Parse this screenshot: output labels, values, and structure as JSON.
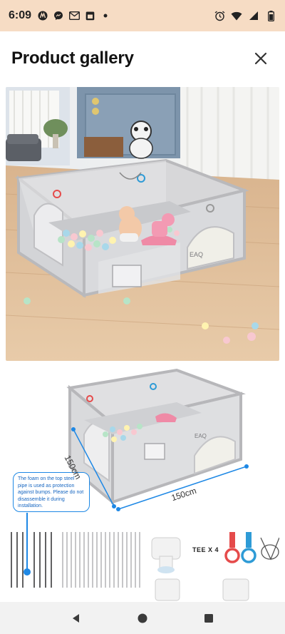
{
  "status_bar": {
    "time": "6:09",
    "left_icons": [
      "motorola-icon",
      "messenger-icon",
      "gmail-icon",
      "calendar-icon",
      "dot-icon"
    ],
    "right_icons": [
      "alarm-icon",
      "wifi-icon",
      "signal-icon",
      "battery-icon"
    ]
  },
  "header": {
    "title": "Product gallery",
    "close_icon": "close-icon"
  },
  "gallery": {
    "images": [
      {
        "name": "playpen-room-photo",
        "brand_text": "EAQ"
      },
      {
        "name": "playpen-dimensions-diagram",
        "brand_text": "EAQ",
        "dimension_depth": "150cm",
        "dimension_width": "150cm",
        "callout_text": "The foam on the top steel pipe is used as protection against bumps. Please do not disassemble it during installation.",
        "tee_label": "TEE X 4"
      }
    ]
  },
  "nav_bar": {
    "buttons": [
      "back-icon",
      "home-icon",
      "recents-icon"
    ]
  },
  "colors": {
    "status_bg": "#f6dcc4",
    "accent_blue": "#1e88e5",
    "playpen_grey": "#c9c9cb"
  }
}
